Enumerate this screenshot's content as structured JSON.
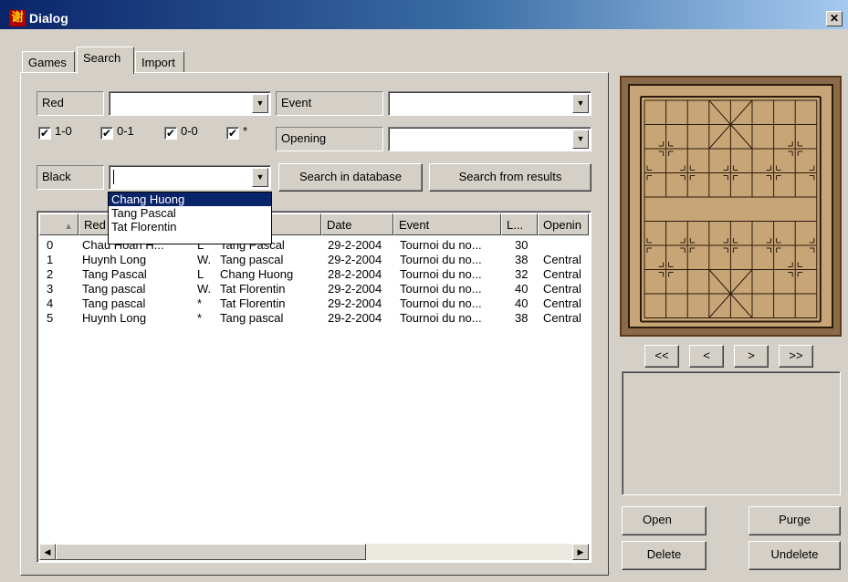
{
  "window": {
    "title": "Dialog",
    "close_label": "✕",
    "app_icon_glyph": "谢"
  },
  "tabs": [
    {
      "label": "Games",
      "active": false
    },
    {
      "label": "Search",
      "active": true
    },
    {
      "label": "Import",
      "active": false
    }
  ],
  "search": {
    "red_label": "Red",
    "red_value": "",
    "event_label": "Event",
    "event_value": "",
    "opening_label": "Opening",
    "opening_value": "",
    "black_label": "Black",
    "black_value": "",
    "checks": [
      {
        "label": "1-0",
        "checked": true
      },
      {
        "label": "0-1",
        "checked": true
      },
      {
        "label": "0-0",
        "checked": true
      },
      {
        "label": "*",
        "checked": true
      }
    ],
    "search_db_label": "Search in database",
    "search_results_label": "Search from results"
  },
  "dropdown": {
    "options": [
      "Chang Huong",
      "Tang Pascal",
      "Tat Florentin"
    ],
    "selected_index": 0
  },
  "table": {
    "columns": [
      "",
      "Red",
      "",
      "",
      "Date",
      "Event",
      "L...",
      "Openin"
    ],
    "rows": [
      [
        "0",
        "Chau Hoan H...",
        "L",
        "Tang Pascal",
        "29-2-2004",
        "Tournoi du no...",
        "30",
        ""
      ],
      [
        "1",
        "Huynh Long",
        "W.",
        "Tang pascal",
        "29-2-2004",
        "Tournoi du no...",
        "38",
        "Central"
      ],
      [
        "2",
        "Tang Pascal",
        "L",
        "Chang Huong",
        "28-2-2004",
        "Tournoi du no...",
        "32",
        "Central"
      ],
      [
        "3",
        "Tang pascal",
        "W.",
        "Tat Florentin",
        "29-2-2004",
        "Tournoi du no...",
        "40",
        "Central"
      ],
      [
        "4",
        "Tang pascal",
        "*",
        "Tat Florentin",
        "29-2-2004",
        "Tournoi du no...",
        "40",
        "Central"
      ],
      [
        "5",
        "Huynh Long",
        "*",
        "Tang pascal",
        "29-2-2004",
        "Tournoi du no...",
        "38",
        "Central"
      ]
    ]
  },
  "navigation": {
    "first": "<<",
    "prev": "<",
    "next": ">",
    "last": ">>"
  },
  "actions": {
    "open": "Open",
    "purge": "Purge",
    "delete": "Delete",
    "undelete": "Undelete"
  },
  "colors": {
    "face": "#d4d0c8",
    "selection": "#0a246a",
    "board": "#c8a577",
    "frame": "#8b6a4a"
  }
}
